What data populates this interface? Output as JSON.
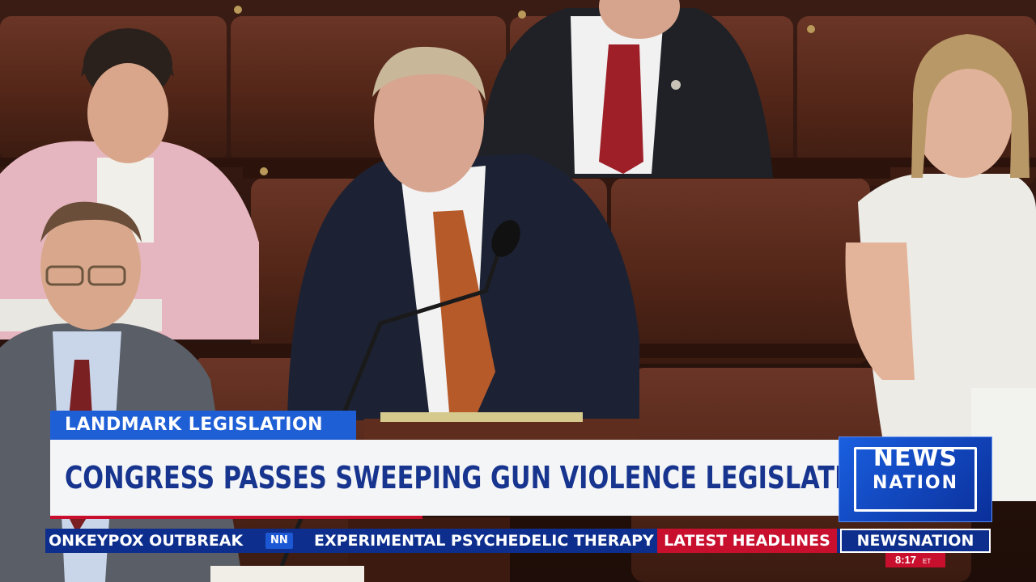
{
  "lower_third": {
    "label": "LANDMARK LEGISLATION",
    "headline": "CONGRESS PASSES SWEEPING GUN VIOLENCE LEGISLATION"
  },
  "logo": {
    "line1": "NEWS",
    "line2": "NATION"
  },
  "ticker": {
    "item1": "ONKEYPOX OUTBREAK",
    "separator": "NN",
    "item2": "EXPERIMENTAL PSYCHEDELIC THERAPY",
    "latest_label": "LATEST HEADLINES",
    "brand": "NEWSNATION"
  },
  "clock": {
    "time": "8:17",
    "zone": "ET"
  },
  "colors": {
    "accent_blue": "#1f5fd6",
    "navy": "#0d2e8c",
    "red": "#c8102e",
    "headline_text": "#17358f"
  }
}
